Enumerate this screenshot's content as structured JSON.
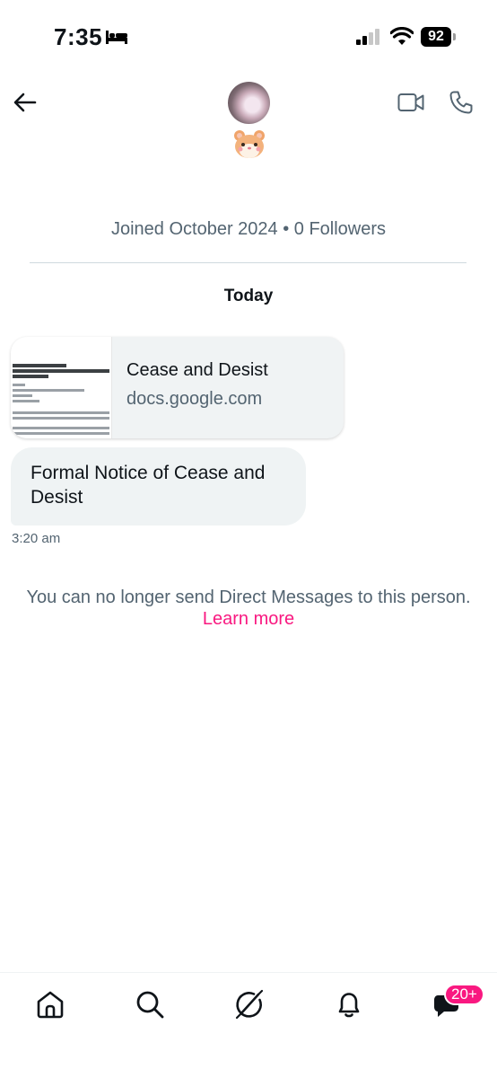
{
  "status_bar": {
    "time": "7:35",
    "battery": "92"
  },
  "header": {
    "avatar_icon": "avatar-photo",
    "name_emoji_icon": "hamster-face-emoji"
  },
  "profile_info": "Joined October 2024 • 0 Followers",
  "date_separator": "Today",
  "link_card": {
    "title": "Cease and Desist",
    "domain": "docs.google.com"
  },
  "message": {
    "text": "Formal Notice of Cease and Desist",
    "time": "3:20 am"
  },
  "notice": {
    "text": "You can no longer send Direct Messages to this person.",
    "link": "Learn more"
  },
  "bottom_nav": {
    "messages_badge": "20+"
  },
  "colors": {
    "accent_pink": "#f91880",
    "secondary_text": "#536471",
    "bubble_bg": "#eff3f4"
  }
}
